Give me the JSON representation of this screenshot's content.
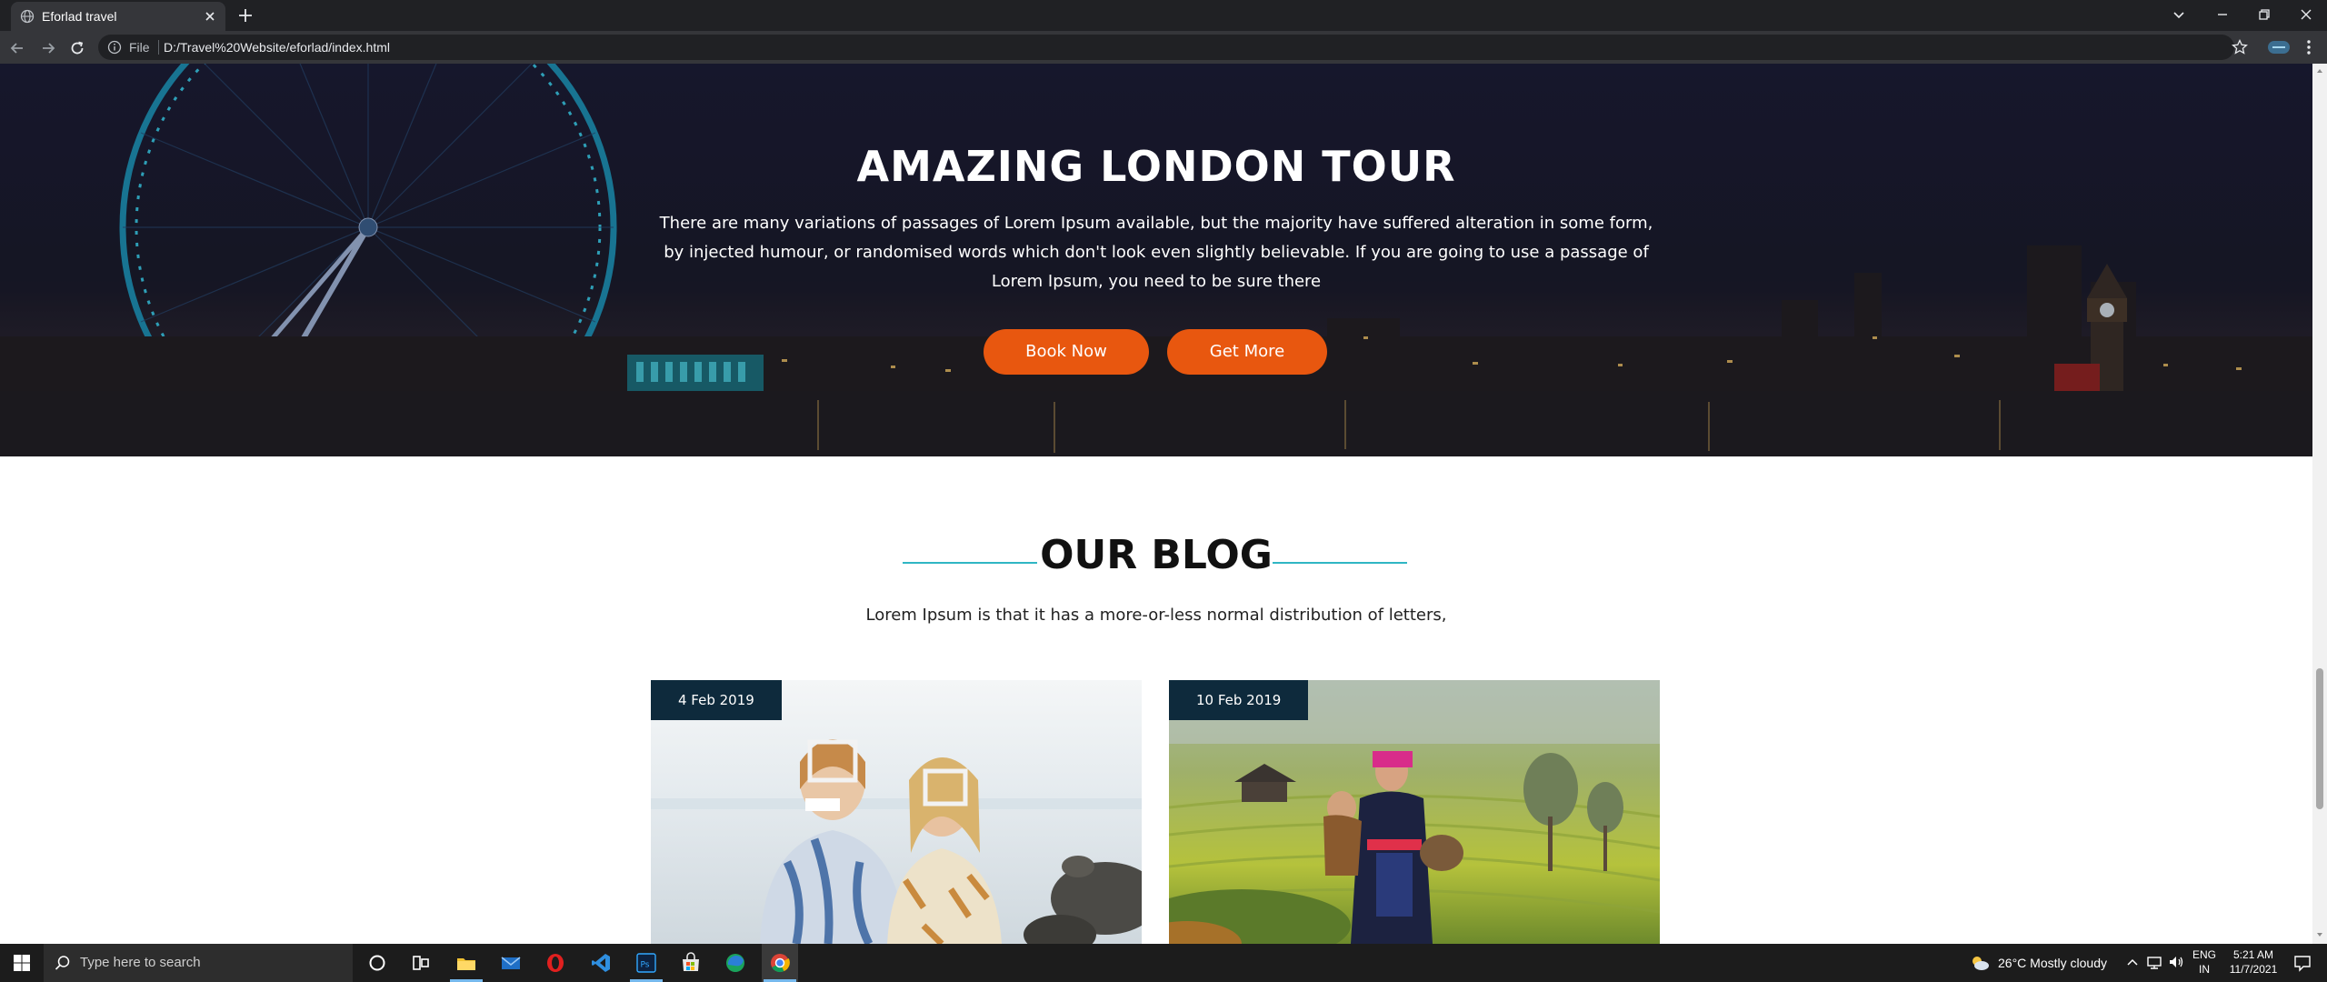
{
  "browser": {
    "tab_title": "Eforlad travel",
    "omnibox_file_label": "File",
    "url": "D:/Travel%20Website/eforlad/index.html"
  },
  "hero": {
    "title": "AMAZING LONDON TOUR",
    "description": "There are many variations of passages of Lorem Ipsum available, but the majority have suffered alteration in some form, by injected humour, or randomised words which don't look even slightly believable. If you are going to use a passage of Lorem Ipsum, you need to be sure there",
    "book_button": "Book Now",
    "more_button": "Get More"
  },
  "blog": {
    "title": "OUR BLOG",
    "subtitle": "Lorem Ipsum is that it has a more-or-less normal distribution of letters,",
    "posts": [
      {
        "date": "4 Feb 2019"
      },
      {
        "date": "10 Feb 2019"
      }
    ]
  },
  "taskbar": {
    "search_placeholder": "Type here to search",
    "weather": "26°C  Mostly cloudy",
    "lang_1": "ENG",
    "lang_2": "IN",
    "time": "5:21 AM",
    "date": "11/7/2021"
  },
  "colors": {
    "accent_orange": "#e8570f",
    "accent_teal": "#2fb6c4",
    "badge_navy": "#0e2a3c",
    "chrome_dark": "#202124"
  }
}
